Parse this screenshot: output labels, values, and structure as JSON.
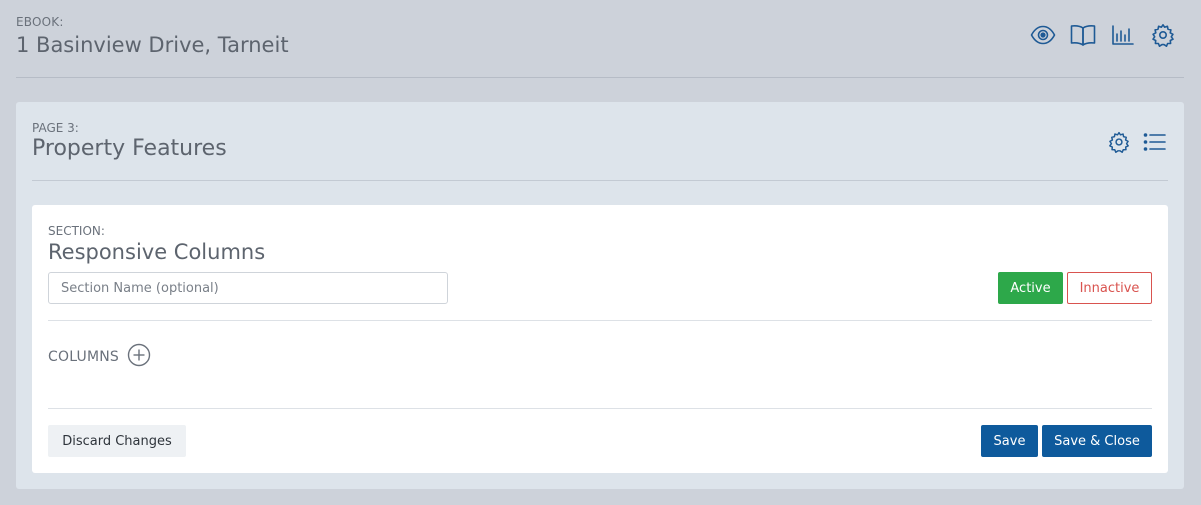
{
  "ebook": {
    "label": "EBOOK:",
    "title": "1 Basinview Drive, Tarneit",
    "icons": [
      "eye-icon",
      "book-open-icon",
      "bar-chart-icon",
      "gear-icon"
    ]
  },
  "page": {
    "label": "PAGE 3:",
    "title": "Property Features",
    "icons": [
      "gear-icon",
      "list-icon"
    ]
  },
  "section": {
    "label": "SECTION:",
    "title": "Responsive Columns",
    "name_input": {
      "value": "",
      "placeholder": "Section Name (optional)"
    },
    "status": {
      "active_label": "Active",
      "inactive_label": "Innactive",
      "selected": "Active"
    },
    "columns_label": "COLUMNS",
    "add_column_icon": "plus-circle-icon",
    "actions": {
      "discard_label": "Discard Changes",
      "save_label": "Save",
      "save_close_label": "Save & Close"
    }
  },
  "colors": {
    "background": "#cdd2da",
    "page_card": "#dde4eb",
    "primary": "#0e5a9c",
    "active_green": "#2da84a",
    "inactive_red": "#d9534f",
    "icon_blue": "#1e5a95"
  }
}
